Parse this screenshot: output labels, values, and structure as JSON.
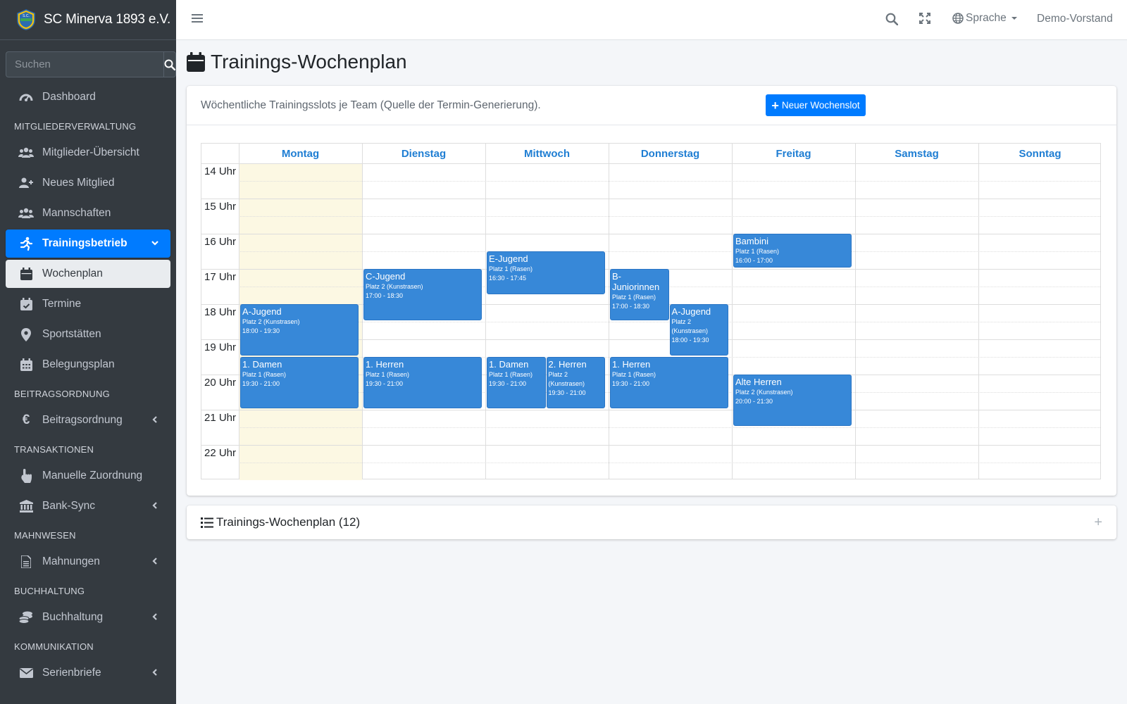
{
  "brand": {
    "name": "SC Minerva 1893 e.V.",
    "logo_text": "S.C."
  },
  "sidebar": {
    "search_placeholder": "Suchen",
    "items": [
      {
        "label": "Dashboard"
      },
      {
        "header": "MITGLIEDERVERWALTUNG"
      },
      {
        "label": "Mitglieder-Übersicht"
      },
      {
        "label": "Neues Mitglied"
      },
      {
        "label": "Mannschaften"
      },
      {
        "label": "Trainingsbetrieb"
      },
      {
        "label": "Wochenplan"
      },
      {
        "label": "Termine"
      },
      {
        "label": "Sportstätten"
      },
      {
        "label": "Belegungsplan"
      },
      {
        "header": "BEITRAGSORDNUNG"
      },
      {
        "label": "Beitragsordnung"
      },
      {
        "header": "TRANSAKTIONEN"
      },
      {
        "label": "Manuelle Zuordnung"
      },
      {
        "label": "Bank-Sync"
      },
      {
        "header": "MAHNWESEN"
      },
      {
        "label": "Mahnungen"
      },
      {
        "header": "BUCHHALTUNG"
      },
      {
        "label": "Buchhaltung"
      },
      {
        "header": "KOMMUNIKATION"
      },
      {
        "label": "Serienbriefe"
      }
    ]
  },
  "topbar": {
    "language": "Sprache",
    "user": "Demo-Vorstand"
  },
  "page": {
    "title": "Trainings-Wochenplan",
    "description": "Wöchentliche Trainingsslots je Team (Quelle der Termin-Generierung).",
    "new_button": "Neuer Wochenslot"
  },
  "calendar": {
    "days": [
      "Montag",
      "Dienstag",
      "Mittwoch",
      "Donnerstag",
      "Freitag",
      "Samstag",
      "Sonntag"
    ],
    "hours": [
      "14 Uhr",
      "15 Uhr",
      "16 Uhr",
      "17 Uhr",
      "18 Uhr",
      "19 Uhr",
      "20 Uhr",
      "21 Uhr",
      "22 Uhr"
    ],
    "events": [
      {
        "title": "A-Jugend",
        "place": "Platz 2 (Kunstrasen)",
        "time": "18:00 - 19:30",
        "day": 0
      },
      {
        "title": "1. Damen",
        "place": "Platz 1 (Rasen)",
        "time": "19:30 - 21:00",
        "day": 0
      },
      {
        "title": "C-Jugend",
        "place": "Platz 2 (Kunstrasen)",
        "time": "17:00 - 18:30",
        "day": 1
      },
      {
        "title": "1. Herren",
        "place": "Platz 1 (Rasen)",
        "time": "19:30 - 21:00",
        "day": 1
      },
      {
        "title": "E-Jugend",
        "place": "Platz 1 (Rasen)",
        "time": "16:30 - 17:45",
        "day": 2
      },
      {
        "title": "1. Damen",
        "place": "Platz 1 (Rasen)",
        "time": "19:30 - 21:00",
        "day": 2
      },
      {
        "title": "2. Herren",
        "place": "Platz 2 (Kunstrasen)",
        "time": "19:30 - 21:00",
        "day": 2
      },
      {
        "title": "B-Juniorinnen",
        "place": "Platz 1 (Rasen)",
        "time": "17:00 - 18:30",
        "day": 3
      },
      {
        "title": "A-Jugend",
        "place": "Platz 2 (Kunstrasen)",
        "time": "18:00 - 19:30",
        "day": 3
      },
      {
        "title": "1. Herren",
        "place": "Platz 1 (Rasen)",
        "time": "19:30 - 21:00",
        "day": 3
      },
      {
        "title": "Bambini",
        "place": "Platz 1 (Rasen)",
        "time": "16:00 - 17:00",
        "day": 4
      },
      {
        "title": "Alte Herren",
        "place": "Platz 2 (Kunstrasen)",
        "time": "20:00 - 21:30",
        "day": 4
      }
    ]
  },
  "list_card": {
    "title": "Trainings-Wochenplan (12)"
  },
  "colors": {
    "sidebar": "#343a40",
    "accent": "#007bff",
    "event": "#3788d8",
    "today": "#fcf8e3",
    "day_header": "#1f7ed3"
  }
}
